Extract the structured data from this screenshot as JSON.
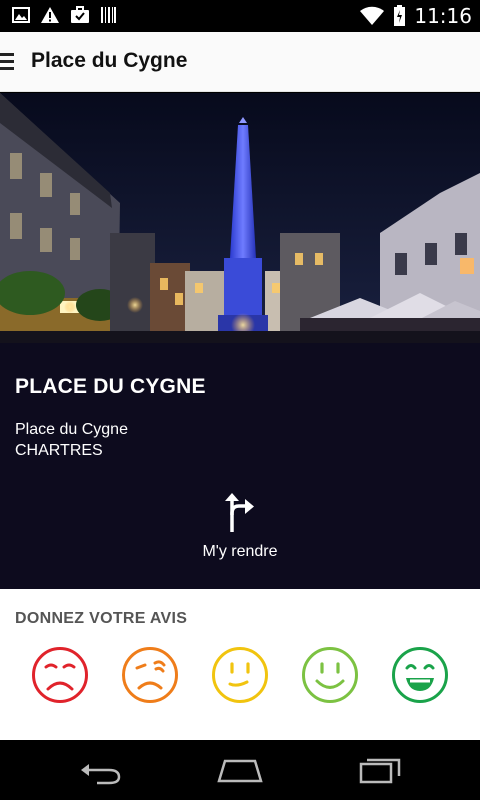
{
  "status_bar": {
    "time": "11:16",
    "left_icons": [
      "image-icon",
      "warning-icon",
      "briefcase-icon",
      "barcode-icon"
    ],
    "right_icons": [
      "wifi-icon",
      "battery-icon"
    ]
  },
  "app_bar": {
    "title": "Place du Cygne",
    "menu_icon": "menu-icon"
  },
  "hero": {
    "image": "night-obelisk-photo"
  },
  "place": {
    "name": "PLACE DU CYGNE",
    "address_line1": "Place du Cygne",
    "address_line2": "CHARTRES",
    "directions_label": "M'y rendre",
    "directions_icon": "directions-icon"
  },
  "feedback": {
    "title": "DONNEZ VOTRE AVIS",
    "ratings": [
      {
        "name": "very-unhappy-icon",
        "color": "#e0232b"
      },
      {
        "name": "unhappy-icon",
        "color": "#ef7d1a"
      },
      {
        "name": "neutral-icon",
        "color": "#f1c40f"
      },
      {
        "name": "happy-icon",
        "color": "#7cc242"
      },
      {
        "name": "very-happy-icon",
        "color": "#1aa34a"
      }
    ]
  },
  "nav_bar": {
    "buttons": [
      "back-icon",
      "home-icon",
      "recents-icon"
    ]
  }
}
